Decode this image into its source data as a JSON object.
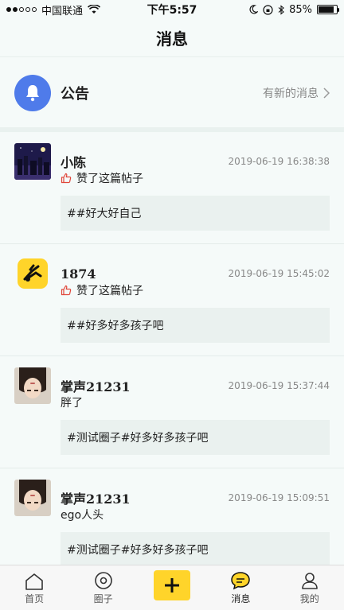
{
  "status_bar": {
    "carrier": "中国联通",
    "time": "下午5:57",
    "battery": "85%",
    "battery_level": 0.85
  },
  "header": {
    "title": "消息"
  },
  "announcement": {
    "title": "公告",
    "link": "有新的消息",
    "accent": "#4f7bea"
  },
  "messages": [
    {
      "name": "小陈",
      "time": "2019-06-19 16:38:38",
      "action": "赞了这篇帖子",
      "quote": "##好大好自己"
    },
    {
      "name": "1874",
      "time": "2019-06-19 15:45:02",
      "action": "赞了这篇帖子",
      "quote": "##好多好多孩子吧"
    },
    {
      "name": "掌声21231",
      "time": "2019-06-19 15:37:44",
      "text": "胖了",
      "quote": "#测试圈子#好多好多孩子吧"
    },
    {
      "name": "掌声21231",
      "time": "2019-06-19 15:09:51",
      "text": "ego人头",
      "quote": "#测试圈子#好多好多孩子吧"
    }
  ],
  "tabs": [
    {
      "label": "首页",
      "icon": "home-icon"
    },
    {
      "label": "圈子",
      "icon": "circle-icon"
    },
    {
      "label": "",
      "icon": "plus-icon"
    },
    {
      "label": "消息",
      "icon": "message-icon"
    },
    {
      "label": "我的",
      "icon": "profile-icon"
    }
  ],
  "colors": {
    "accent": "#ffd42a",
    "like": "#e0463a"
  }
}
